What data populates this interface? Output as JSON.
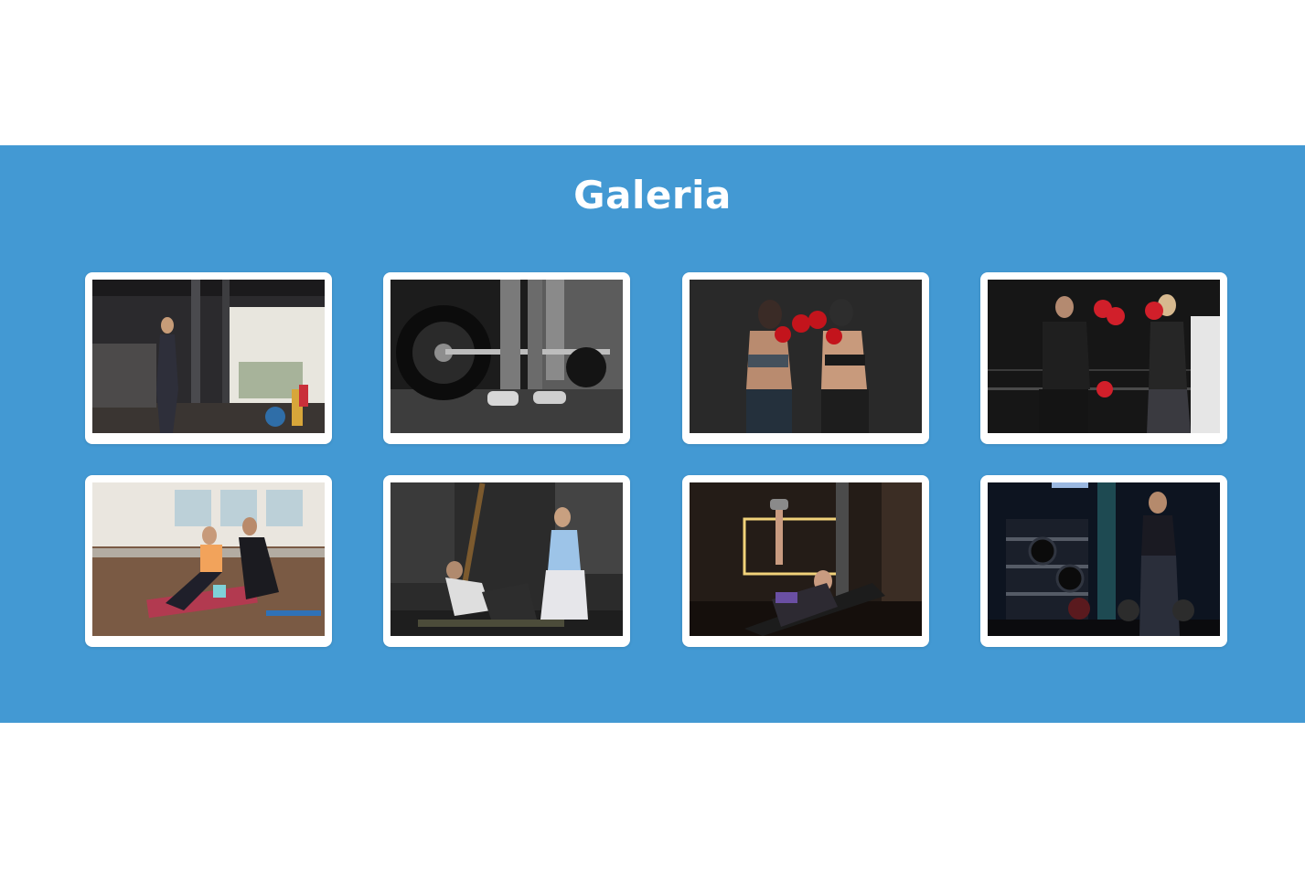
{
  "gallery": {
    "title": "Galeria",
    "background_color": "#4399d3",
    "card_color": "#ffffff",
    "items": [
      {
        "kind": "photo",
        "subject": "cable-machine-training",
        "colors": {
          "bg": "#2b2a2d",
          "accent": "#e8e6de",
          "floor": "#3a3532"
        }
      },
      {
        "kind": "photo",
        "subject": "barbell-deadlift-monochrome",
        "colors": {
          "bg": "#1c1c1c",
          "accent": "#bdbdbd",
          "floor": "#3d3d3d"
        }
      },
      {
        "kind": "photo",
        "subject": "kickboxing-sparring",
        "colors": {
          "bg": "#2a2a2a",
          "accent": "#c3141c",
          "floor": "#1a1a1a"
        }
      },
      {
        "kind": "photo",
        "subject": "boxing-pads-training",
        "colors": {
          "bg": "#161616",
          "accent": "#d11f2a",
          "floor": "#222222"
        }
      },
      {
        "kind": "photo",
        "subject": "stretching-with-coach",
        "colors": {
          "bg": "#d8d2c8",
          "accent": "#f2a35b",
          "floor": "#7a5a44"
        }
      },
      {
        "kind": "photo",
        "subject": "partner-situps",
        "colors": {
          "bg": "#2b2b2b",
          "accent": "#9dc4e8",
          "floor": "#1e1e1e"
        }
      },
      {
        "kind": "photo",
        "subject": "dumbbell-bench-press",
        "colors": {
          "bg": "#241c17",
          "accent": "#f1d27a",
          "floor": "#150f0c"
        }
      },
      {
        "kind": "photo",
        "subject": "athlete-with-plates",
        "colors": {
          "bg": "#0d1420",
          "accent": "#4a78b8",
          "floor": "#0b0b0e"
        }
      }
    ]
  }
}
